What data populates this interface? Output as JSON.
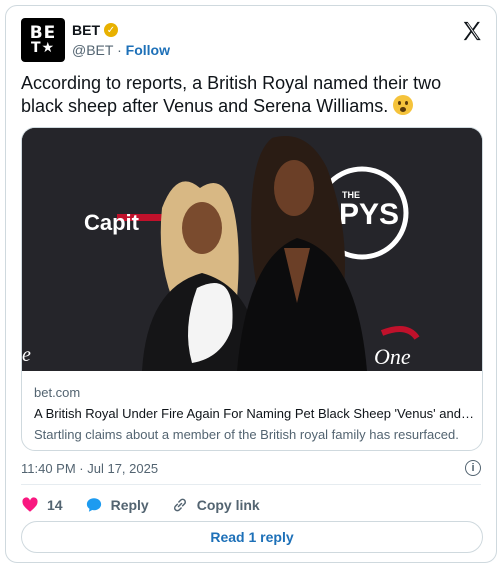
{
  "account": {
    "name": "BET",
    "handle": "@BET",
    "separator": "·",
    "follow_label": "Follow",
    "avatar_line1": "BE",
    "avatar_line2": "T★",
    "verified_icon": "gold-check-badge"
  },
  "post": {
    "text": "According to reports, a British Royal named their two black sheep after Venus and Serena Williams.",
    "emoji": "astonished-face"
  },
  "link_card": {
    "domain": "bet.com",
    "headline": "A British Royal Under Fire Again For Naming Pet Black Sheep 'Venus' and Serena'",
    "description": "Startling claims about a member of the British royal family has resurfaced."
  },
  "meta": {
    "timestamp": "11:40 PM · Jul 17, 2025"
  },
  "actions": {
    "like_count": "14",
    "reply_label": "Reply",
    "copy_label": "Copy link",
    "read_replies_label": "Read 1 reply"
  },
  "colors": {
    "link_blue": "#1d70b8",
    "like_red": "#f91880",
    "reply_blue": "#1d9bf0",
    "verified_gold": "#e8b100"
  }
}
